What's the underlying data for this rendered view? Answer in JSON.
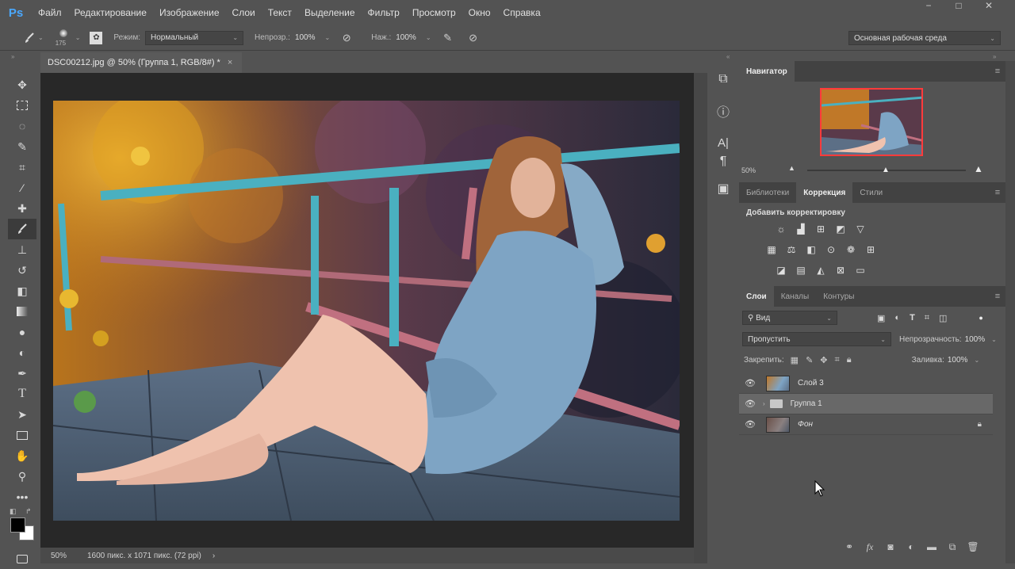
{
  "app": {
    "logo": "Ps"
  },
  "menu": {
    "items": [
      "Файл",
      "Редактирование",
      "Изображение",
      "Слои",
      "Текст",
      "Выделение",
      "Фильтр",
      "Просмотр",
      "Окно",
      "Справка"
    ]
  },
  "window_controls": {
    "minimize": "−",
    "restore": "□",
    "close": "✕"
  },
  "options": {
    "brush_size": "175",
    "mode_label": "Режим:",
    "mode_value": "Нормальный",
    "opacity_label": "Непрозр.:",
    "opacity_value": "100%",
    "pressure_label": "Наж.:",
    "pressure_value": "100%",
    "workspace": "Основная рабочая среда"
  },
  "document": {
    "tab_title": "DSC00212.jpg @ 50% (Группа 1, RGB/8#) *",
    "close": "×"
  },
  "status": {
    "zoom": "50%",
    "info": "1600 пикс. x 1071 пикс. (72 ppi)",
    "arrow": "›"
  },
  "navigator": {
    "title": "Навигатор",
    "zoom": "50%",
    "zoom_level": 0.5
  },
  "adjustments": {
    "tabs": [
      "Библиотеки",
      "Коррекция",
      "Стили"
    ],
    "active_tab": 1,
    "heading": "Добавить корректировку",
    "row1": [
      "brightness-icon",
      "levels-icon",
      "curves-icon",
      "exposure-icon",
      "vibrance-icon"
    ],
    "row2": [
      "hue-icon",
      "color-balance-icon",
      "bw-icon",
      "photo-filter-icon",
      "channel-mixer-icon",
      "color-lookup-icon"
    ],
    "row3": [
      "invert-icon",
      "posterize-icon",
      "threshold-icon",
      "selective-color-icon",
      "gradient-map-icon"
    ]
  },
  "layers": {
    "tabs": [
      "Слои",
      "Каналы",
      "Контуры"
    ],
    "active_tab": 0,
    "filter_value": "Вид",
    "blend_value": "Пропустить",
    "opacity_label": "Непрозрачность:",
    "opacity_value": "100%",
    "lock_label": "Закрепить:",
    "fill_label": "Заливка:",
    "fill_value": "100%",
    "items": [
      {
        "name": "Слой 3",
        "type": "layer",
        "visible": true
      },
      {
        "name": "Группа 1",
        "type": "group",
        "visible": true,
        "selected": true
      },
      {
        "name": "Фон",
        "type": "background",
        "visible": true,
        "locked": true
      }
    ]
  },
  "colors": {
    "foreground": "#000000",
    "background": "#ffffff",
    "accent": "#4aa8ff",
    "navigator_box": "#ff3b3b"
  }
}
